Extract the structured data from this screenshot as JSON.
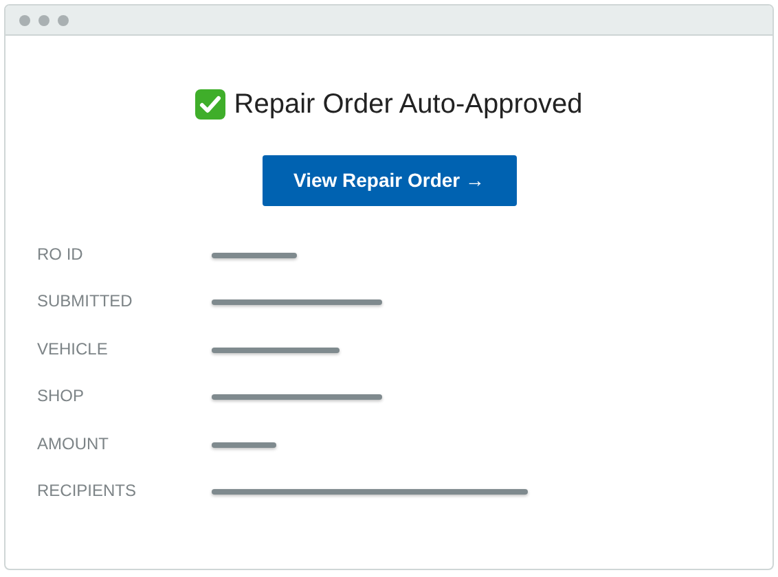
{
  "title": "Repair Order Auto-Approved",
  "button": {
    "label": "View Repair Order →"
  },
  "fields": [
    {
      "label": "RO ID"
    },
    {
      "label": "SUBMITTED"
    },
    {
      "label": "VEHICLE"
    },
    {
      "label": "SHOP"
    },
    {
      "label": "AMOUNT"
    },
    {
      "label": "RECIPIENTS"
    }
  ]
}
